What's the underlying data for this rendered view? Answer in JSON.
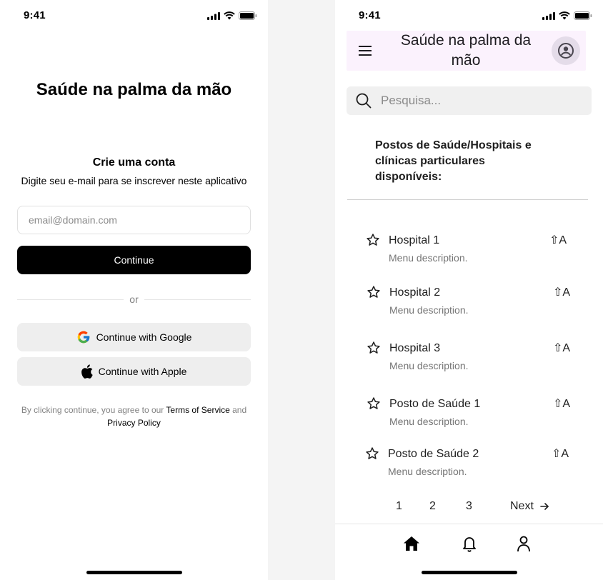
{
  "status_bar": {
    "time": "9:41"
  },
  "signup": {
    "app_title": "Saúde na palma da mão",
    "heading": "Crie uma conta",
    "subtitle": "Digite seu e-mail para se inscrever neste aplicativo",
    "email_placeholder": "email@domain.com",
    "continue_label": "Continue",
    "divider_text": "or",
    "google_label": "Continue with Google",
    "apple_label": "Continue with Apple",
    "terms_prefix": "By clicking continue, you agree to our ",
    "terms_link": "Terms of Service",
    "terms_mid": " and",
    "privacy_link": "Privacy Policy"
  },
  "home": {
    "title": "Saúde na palma da mão",
    "search_placeholder": "Pesquisa...",
    "section_heading": "Postos de Saúde/Hospitais e clínicas particulares disponíveis:",
    "items": [
      {
        "title": "Hospital 1",
        "description": "Menu description.",
        "shortcut": "⇧A"
      },
      {
        "title": "Hospital 2",
        "description": "Menu description.",
        "shortcut": "⇧A"
      },
      {
        "title": "Hospital 3",
        "description": "Menu description.",
        "shortcut": "⇧A"
      },
      {
        "title": "Posto de Saúde 1",
        "description": "Menu description.",
        "shortcut": "⇧A"
      },
      {
        "title": "Posto de Saúde 2",
        "description": "Menu description.",
        "shortcut": "⇧A"
      }
    ],
    "pagination": {
      "pages": [
        "1",
        "2",
        "3"
      ],
      "next_label": "Next"
    },
    "tabs": [
      "home-icon",
      "bell-icon",
      "person-icon"
    ]
  },
  "colors": {
    "top_bar_bg": "#fbf2fd",
    "avatar_bg": "#e4dce9",
    "primary_button": "#000000",
    "social_button_bg": "#eeeeee"
  }
}
